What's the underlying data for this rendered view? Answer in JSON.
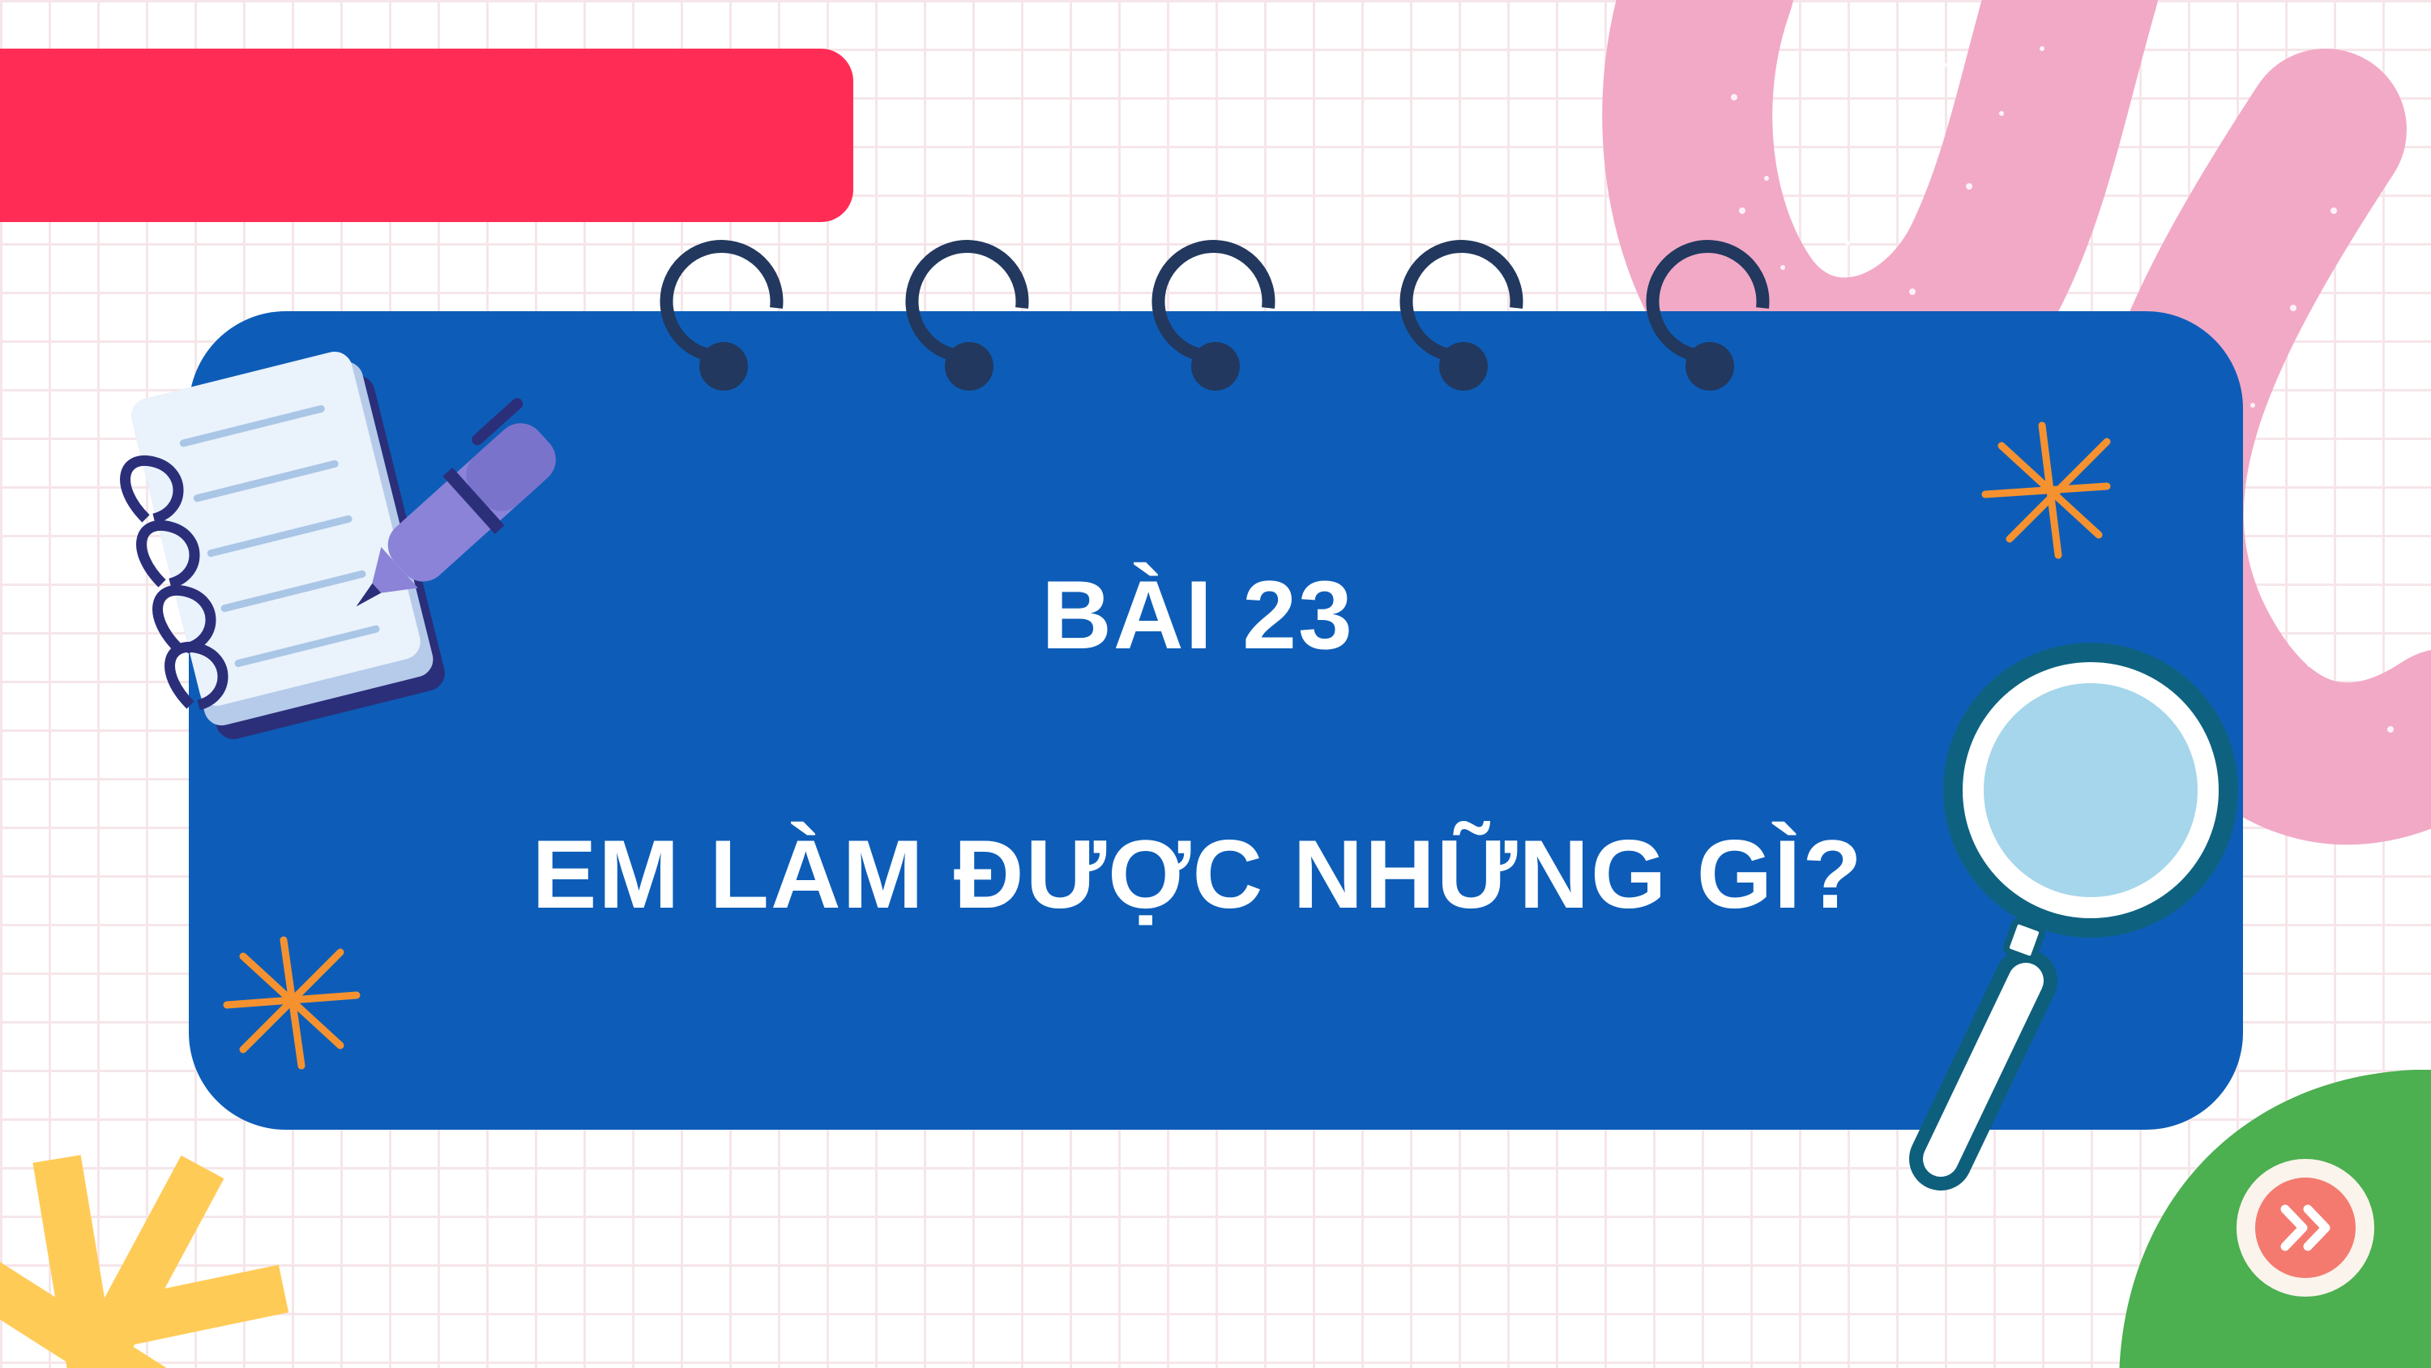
{
  "slide": {
    "title_line_1": "BÀI 23",
    "title_line_2": "EM LÀM ĐƯỢC NHỮNG GÌ?"
  },
  "navigation": {
    "next_icon": "double-chevron-right-icon"
  },
  "colors": {
    "background": "#ffffff",
    "grid": "#f6e6e9",
    "red_bar": "#ff2d55",
    "card": "#0d5db8",
    "pink_squiggle": "#f2a9c6",
    "green_blob": "#4caf50",
    "next_button": "#f47a70",
    "asterisk_orange": "#f5922f",
    "asterisk_yellow": "#ffcb57"
  }
}
